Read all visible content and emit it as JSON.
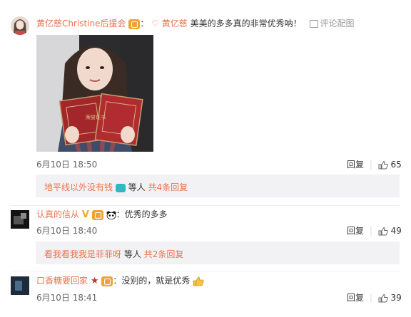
{
  "comment1": {
    "author": "黄亿慈Christine后援会",
    "colon": "：",
    "reply_prefix": "♡ 黄亿慈",
    "text": "美美的多多真的非常优秀呐！",
    "reply_with_image": "评论配图",
    "date": "6月10日 18:50",
    "reply_label": "回复",
    "likes": "65",
    "sub_reply_user": "地平线以外没有钱",
    "sub_reply_suffix": "等人",
    "sub_reply_count": "共4条回复",
    "certificate_text": "荣誉证书"
  },
  "comment2": {
    "author": "认真的信从",
    "colon": "：",
    "text": "优秀的多多",
    "date": "6月10日 18:40",
    "reply_label": "回复",
    "likes": "49",
    "sub_reply_user": "看我看我我是菲菲呀",
    "sub_reply_suffix": "等人",
    "sub_reply_count": "共2条回复"
  },
  "comment3": {
    "author": "口香糖要回家",
    "colon": "：",
    "text": "没别的，就是优秀",
    "date": "6月10日 18:41",
    "reply_label": "回复",
    "likes": "39"
  },
  "colors": {
    "nickname": "#eb7350",
    "reply_bar": "#f2f2f5",
    "badge": "#f0a23a"
  }
}
